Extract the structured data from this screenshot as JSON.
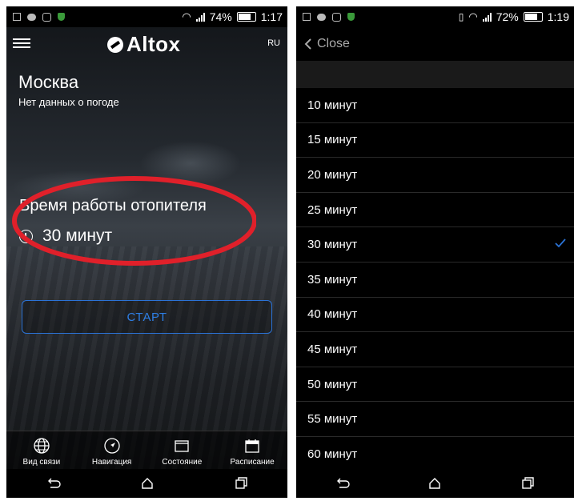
{
  "left": {
    "status": {
      "battery_text": "74%",
      "time": "1:17"
    },
    "app": {
      "logo_text": "Altox",
      "lang": "RU"
    },
    "weather": {
      "city": "Москва",
      "status": "Нет данных о погоде"
    },
    "heater": {
      "title": "Время работы отопителя",
      "value": "30 минут"
    },
    "start_label": "СТАРТ",
    "nav": [
      {
        "label": "Вид связи",
        "icon": "globe-icon"
      },
      {
        "label": "Навигация",
        "icon": "navigation-arrow-icon"
      },
      {
        "label": "Состояние",
        "icon": "status-window-icon"
      },
      {
        "label": "Расписание",
        "icon": "calendar-icon"
      }
    ],
    "colors": {
      "accent": "#2b73d6",
      "highlight": "#e0202a"
    }
  },
  "right": {
    "status": {
      "battery_text": "72%",
      "time": "1:19"
    },
    "close_label": "Close",
    "options": [
      "10 минут",
      "15 минут",
      "20 минут",
      "25 минут",
      "30 минут",
      "35 минут",
      "40 минут",
      "45 минут",
      "50 минут",
      "55 минут",
      "60 минут"
    ],
    "selected": "30 минут",
    "colors": {
      "check": "#2b73d6"
    }
  }
}
